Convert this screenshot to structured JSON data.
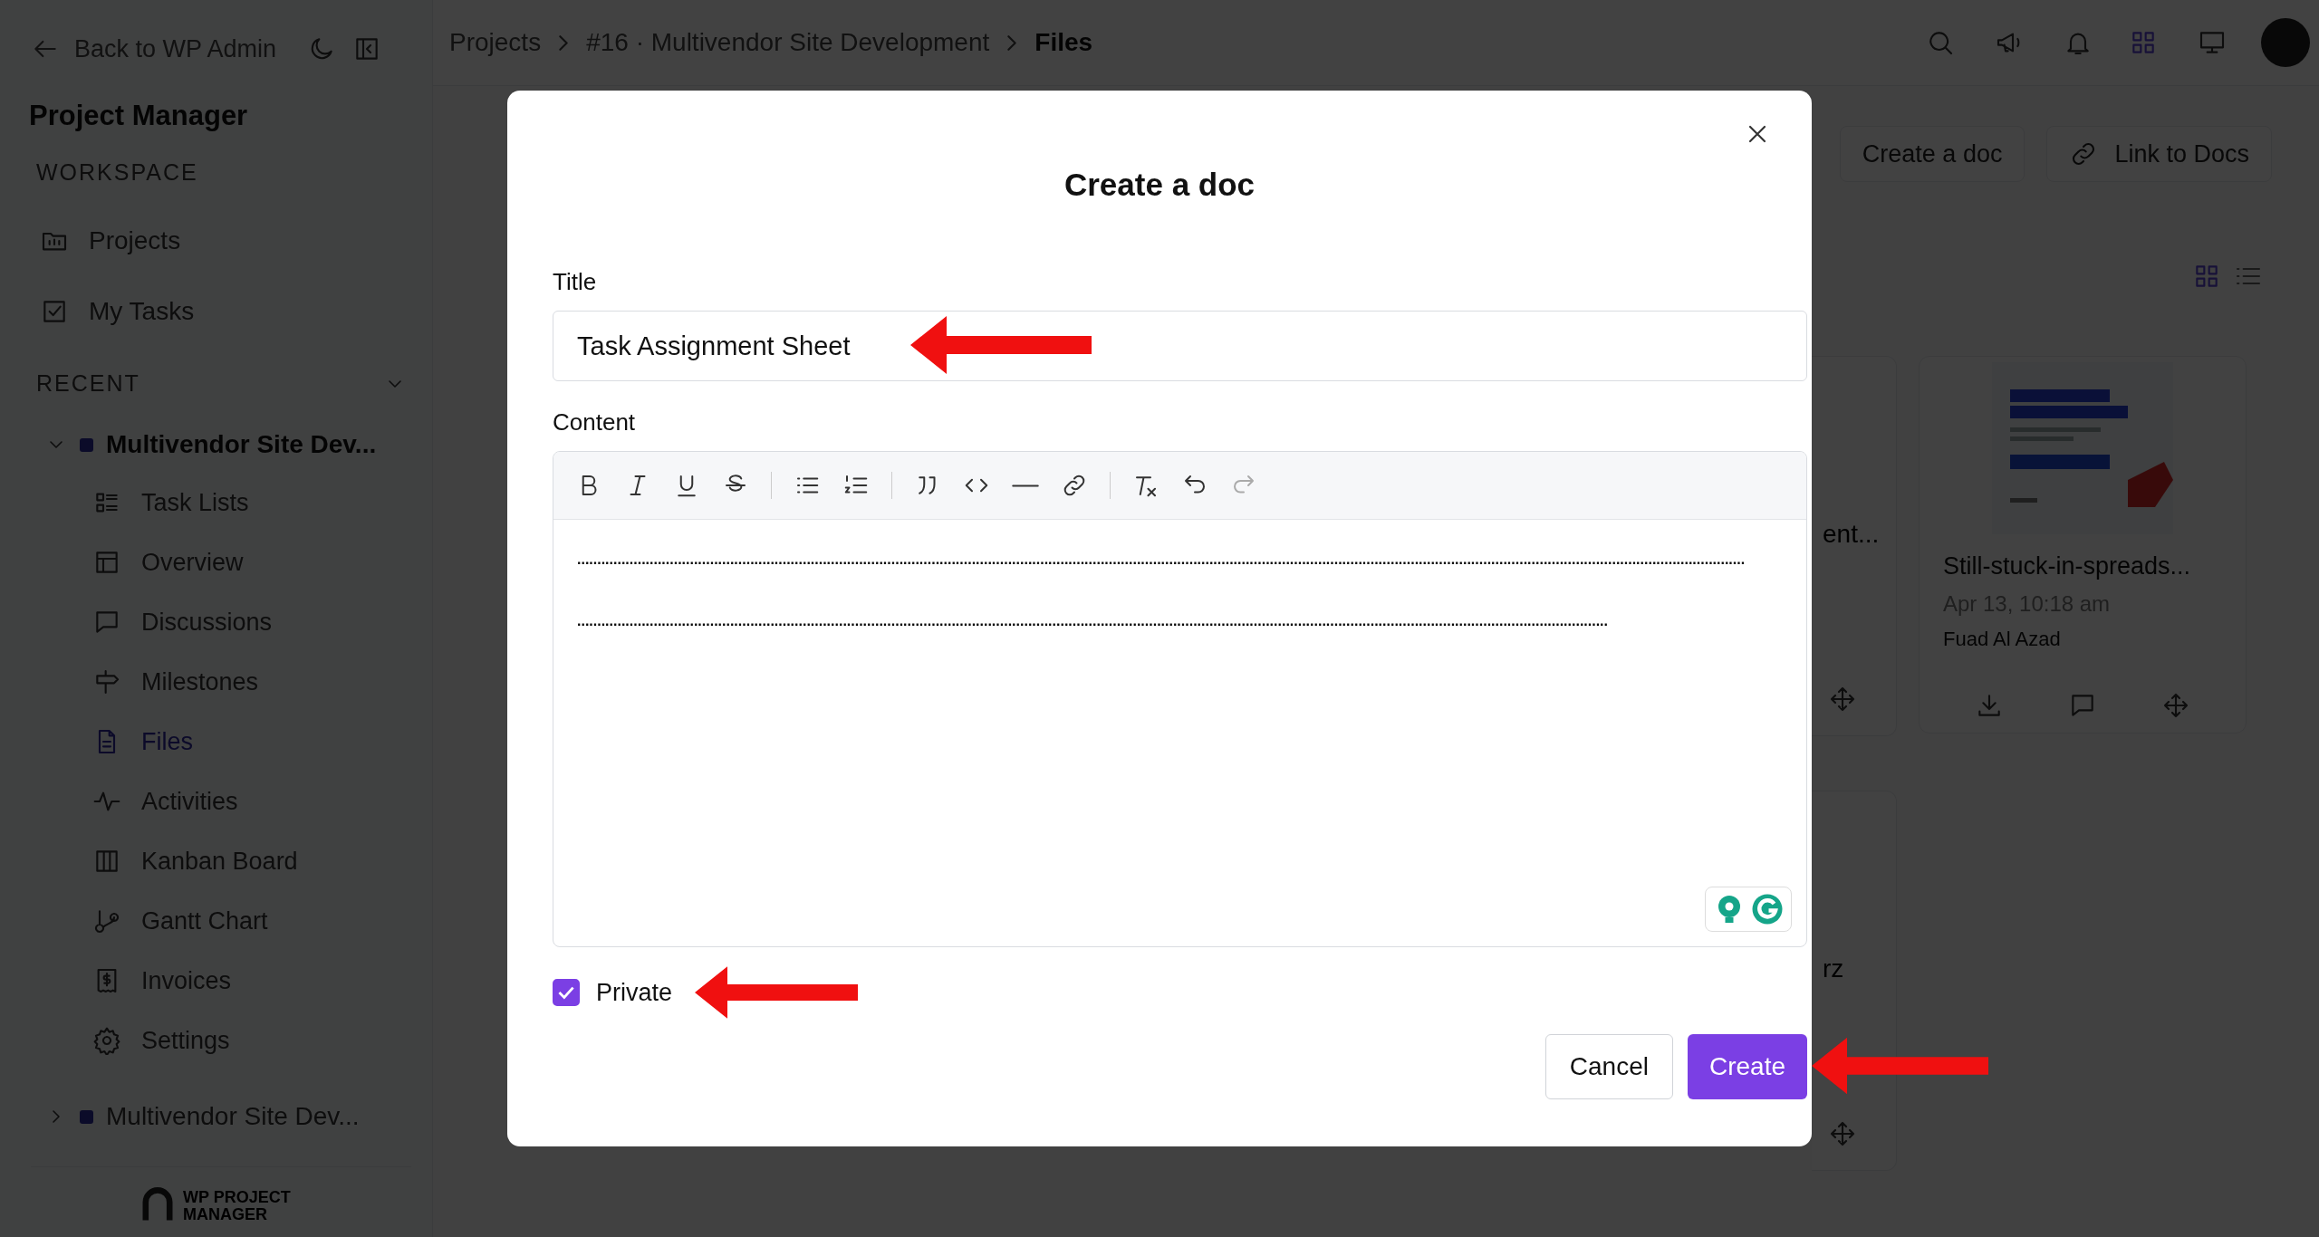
{
  "sidebar": {
    "back_link": "Back to WP Admin",
    "app_title": "Project Manager",
    "workspace_heading": "WORKSPACE",
    "workspace_items": [
      {
        "label": "Projects",
        "selected": false
      },
      {
        "label": "My Tasks",
        "selected": false
      }
    ],
    "recent_heading": "RECENT",
    "recent_expanded": true,
    "projects": [
      {
        "name": "Multivendor Site Dev...",
        "expanded": true,
        "children": [
          {
            "label": "Task Lists",
            "selected": false
          },
          {
            "label": "Overview",
            "selected": false
          },
          {
            "label": "Discussions",
            "selected": false
          },
          {
            "label": "Milestones",
            "selected": false
          },
          {
            "label": "Files",
            "selected": true
          },
          {
            "label": "Activities",
            "selected": false
          },
          {
            "label": "Kanban Board",
            "selected": false
          },
          {
            "label": "Gantt Chart",
            "selected": false
          },
          {
            "label": "Invoices",
            "selected": false
          },
          {
            "label": "Settings",
            "selected": false
          }
        ]
      },
      {
        "name": "Multivendor Site Dev...",
        "expanded": false
      }
    ],
    "logo_text": [
      "WP PROJECT",
      "MANAGER"
    ]
  },
  "breadcrumb": [
    "Projects",
    "#16 · Multivendor Site Development",
    "Files"
  ],
  "actions": [
    "Create a doc",
    "Link to Docs"
  ],
  "view_toggle": [
    {
      "kind": "grid",
      "selected": true
    },
    {
      "kind": "list",
      "selected": false
    }
  ],
  "cards": [
    {
      "kind": "partial",
      "title": "ent..."
    },
    {
      "kind": "picture",
      "title": "Still-stuck-in-spreads...",
      "date": "Apr 13, 10:18 am",
      "author": "Fuad Al Azad"
    },
    {
      "kind": "partial",
      "title": "rz"
    }
  ],
  "modal": {
    "title": "Create a doc",
    "title_label": "Title",
    "title_value": "Task Assignment Sheet",
    "content_label": "Content",
    "content_lines": [
      "..................................................................................................................................................................................................................................................................................................",
      "................................................................................................................................................................................................................................................................"
    ],
    "private": {
      "label": "Private",
      "checked": true
    },
    "buttons": [
      {
        "label": "Cancel",
        "kind": "secondary"
      },
      {
        "label": "Create",
        "kind": "primary"
      }
    ]
  }
}
